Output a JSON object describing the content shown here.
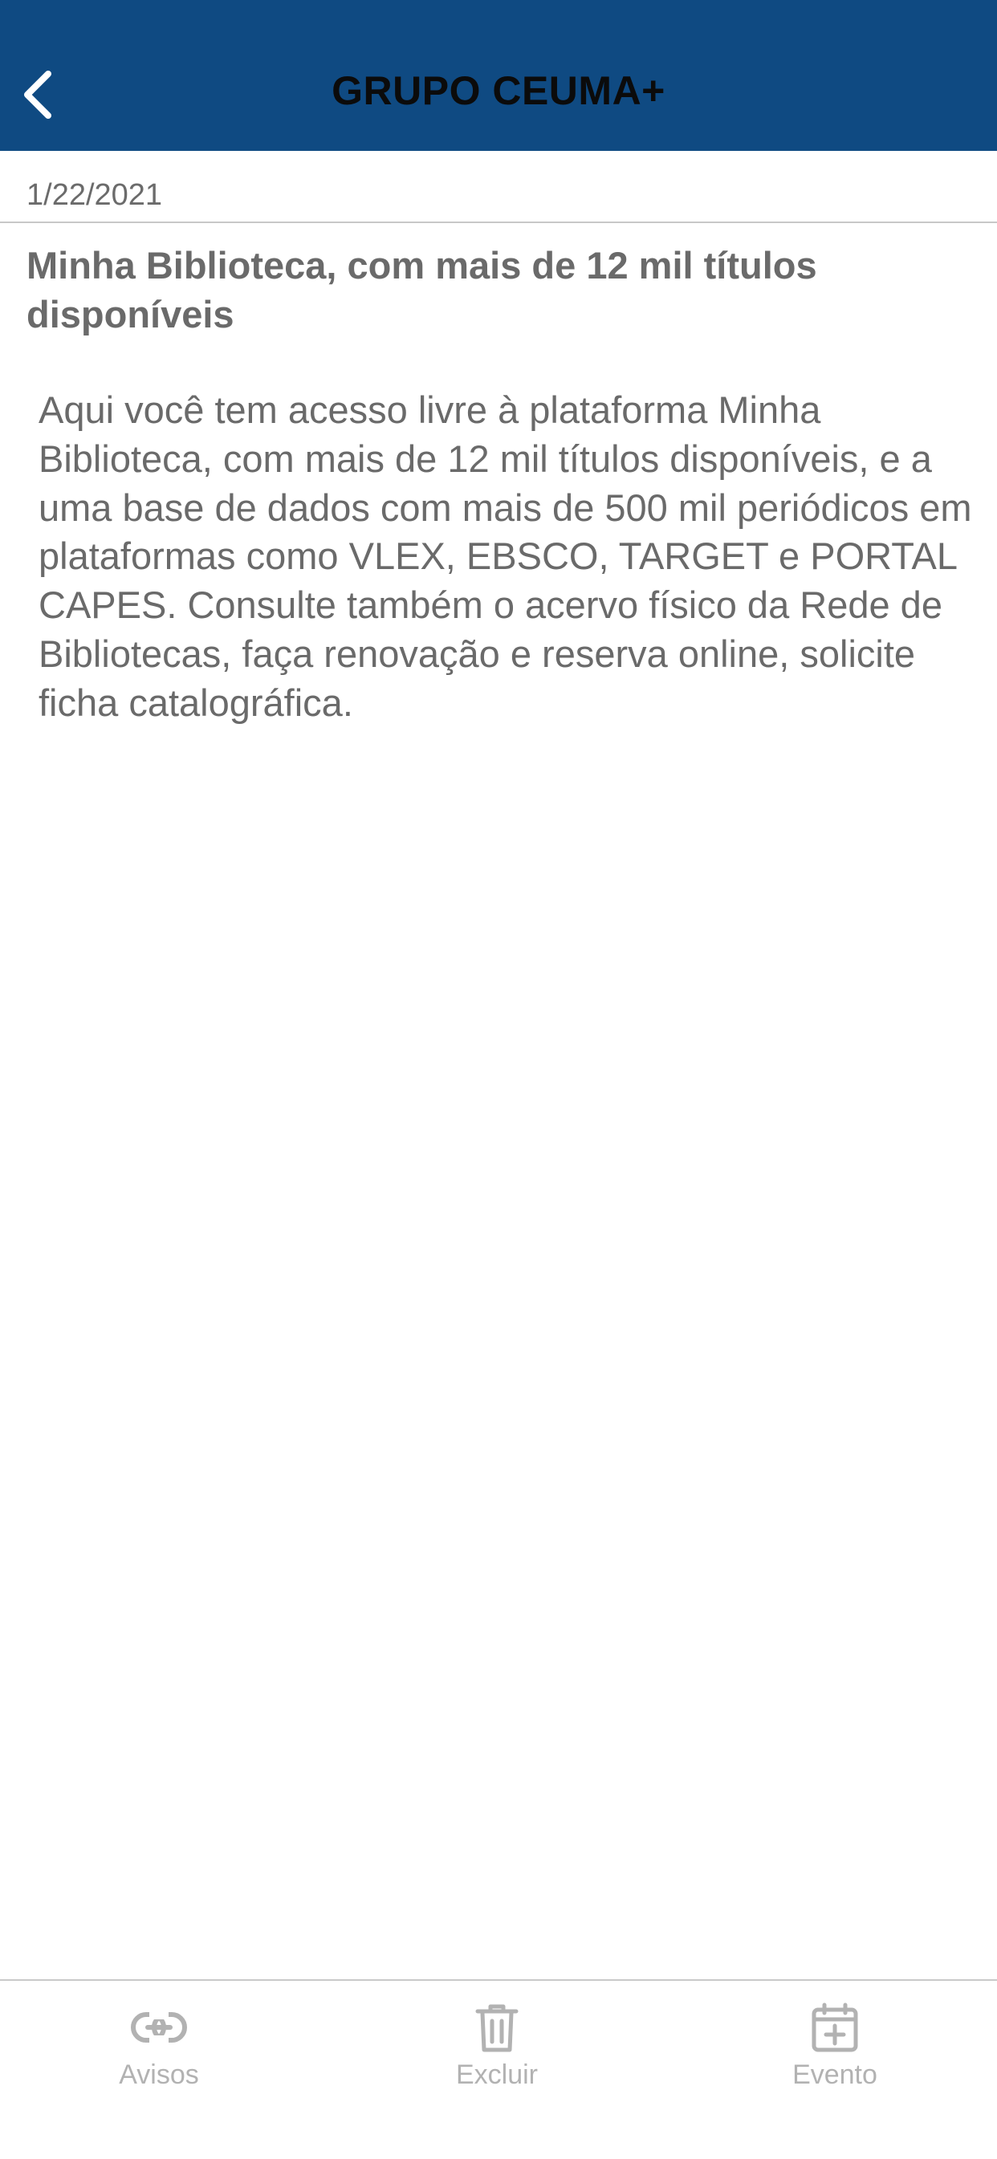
{
  "header": {
    "title": "GRUPO CEUMA+",
    "background": "#0f4a82"
  },
  "notice": {
    "date": "1/22/2021",
    "title": "Minha Biblioteca, com mais de 12 mil títulos disponíveis",
    "body": "Aqui você tem acesso livre à plataforma Minha Biblioteca, com mais de 12 mil títulos disponíveis, e a uma base de dados com mais de 500 mil periódicos em plataformas como VLEX, EBSCO, TARGET e PORTAL CAPES. Consulte também o acervo físico da Rede de Bibliotecas, faça renovação e reserva online, solicite ficha catalográfica."
  },
  "tabbar": {
    "items": [
      {
        "label": "Avisos",
        "icon": "link-icon"
      },
      {
        "label": "Excluir",
        "icon": "trash-icon"
      },
      {
        "label": "Evento",
        "icon": "calendar-plus-icon"
      }
    ],
    "inactive_color": "#b2b2b2"
  }
}
